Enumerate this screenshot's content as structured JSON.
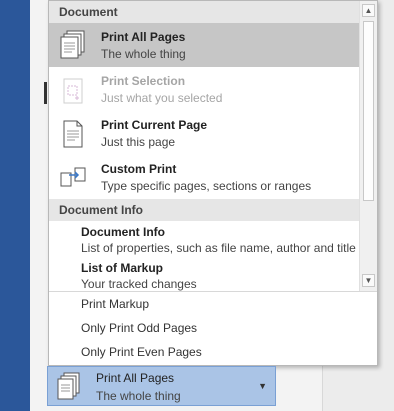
{
  "menu": {
    "sections": [
      {
        "header": "Document",
        "items": [
          {
            "label": "Print All Pages",
            "desc": "The whole thing",
            "icon": "all-pages-icon",
            "selected": true,
            "disabled": false
          },
          {
            "label": "Print Selection",
            "desc": "Just what you selected",
            "icon": "selection-icon",
            "selected": false,
            "disabled": true
          },
          {
            "label": "Print Current Page",
            "desc": "Just this page",
            "icon": "current-page-icon",
            "selected": false,
            "disabled": false
          },
          {
            "label": "Custom Print",
            "desc": "Type specific pages, sections or ranges",
            "icon": "custom-print-icon",
            "selected": false,
            "disabled": false
          }
        ]
      },
      {
        "header": "Document Info",
        "items": [
          {
            "label": "Document Info",
            "desc": "List of properties, such as file name, author and title"
          },
          {
            "label": "List of Markup",
            "desc": "Your tracked changes"
          }
        ]
      }
    ],
    "extra_items": [
      "Print Markup",
      "Only Print Odd Pages",
      "Only Print Even Pages"
    ]
  },
  "print_select": {
    "label": "Print All Pages",
    "desc": "The whole thing",
    "caret": "▼"
  },
  "scrollbar": {
    "up": "▲",
    "down": "▼"
  },
  "colors": {
    "selected_item": "#c6c6c6",
    "dropdown_selected": "#aac4e6",
    "section_header": "#e6e6e6",
    "disabled_text": "#a5a5a5",
    "accent_strip": "#2b579a"
  }
}
